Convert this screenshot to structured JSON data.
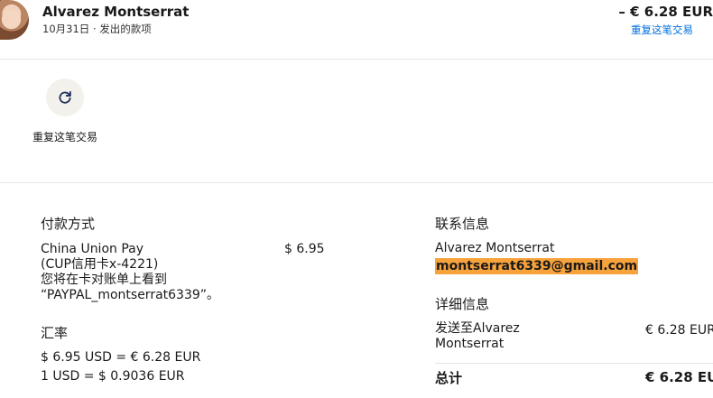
{
  "header": {
    "payee_name": "Alvarez Montserrat",
    "date": "10月31日",
    "separator": "·",
    "type": "发出的款项",
    "amount": "– € 6.28 EUR",
    "repeat_link": "重复这笔交易"
  },
  "actions": {
    "repeat_label": "重复这笔交易",
    "repeat_icon": "refresh-icon"
  },
  "payment_method": {
    "title": "付款方式",
    "lines": [
      "China Union Pay",
      "(CUP信用卡x-4221)",
      "您将在卡对账单上看到",
      "“PAYPAL_montserrat6339”。"
    ],
    "amount": "$ 6.95"
  },
  "exchange_rate": {
    "title": "汇率",
    "line1": "$ 6.95 USD = € 6.28 EUR",
    "line2": "1 USD = $ 0.9036 EUR"
  },
  "contact": {
    "title": "联系信息",
    "name": "Alvarez Montserrat",
    "email": "montserrat6339@gmail.com",
    "email_highlight_color": "#f8a23b"
  },
  "details": {
    "title": "详细信息",
    "sent_to": "发送至Alvarez Montserrat",
    "sent_amount": "€ 6.28 EUR",
    "total_label": "总计",
    "total_amount": "€ 6.28 EUR"
  },
  "colors": {
    "link": "#0070e0",
    "divider": "#e6e6e6",
    "icon_circle": "#f2f1ec"
  }
}
